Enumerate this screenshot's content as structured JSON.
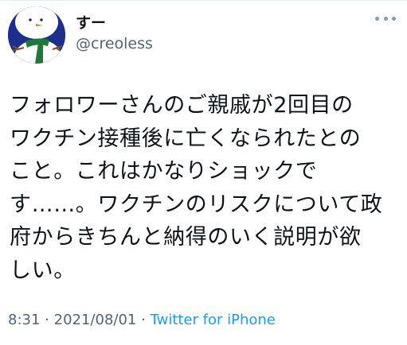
{
  "user": {
    "display_name": "すー",
    "handle": "@creoless"
  },
  "tweet": {
    "lines": [
      "フォロワーさんのご親戚が2回目の",
      "ワクチン接種後に亡くなられたとの",
      "こと。これはかなりショックで",
      "す……。ワクチンのリスクについて政",
      "府からきちんと納得のいく説明が欲",
      "しい。"
    ],
    "time": "8:31",
    "separator": "·",
    "date": "2021/08/01",
    "source": "Twitter for iPhone"
  },
  "icons": {
    "avatar": "snowman-avatar",
    "more": "more-options-icon"
  },
  "colors": {
    "text": "#0f1419",
    "secondary": "#536471",
    "link": "#1d9bf0",
    "avatar_bg": "#1d2f8c"
  }
}
